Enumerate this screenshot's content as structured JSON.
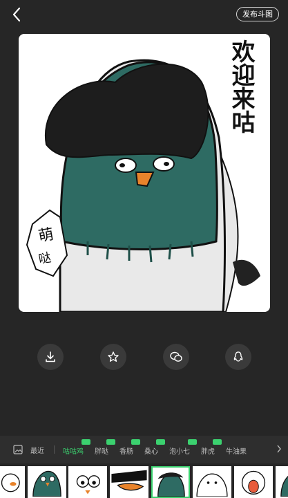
{
  "topbar": {
    "publish_label": "发布斗图"
  },
  "sticker": {
    "title_text": "欢迎来咕"
  },
  "actions": [
    {
      "name": "download"
    },
    {
      "name": "favorite"
    },
    {
      "name": "wechat-share"
    },
    {
      "name": "qq-share"
    }
  ],
  "categories": {
    "recent_label": "最近",
    "items": [
      "咕咕鸡",
      "胖哒",
      "香肠",
      "桑心",
      "泡小七",
      "胖虎",
      "牛油果"
    ],
    "active_index": 0
  },
  "colors": {
    "accent": "#3bd16f",
    "background": "#262626"
  }
}
